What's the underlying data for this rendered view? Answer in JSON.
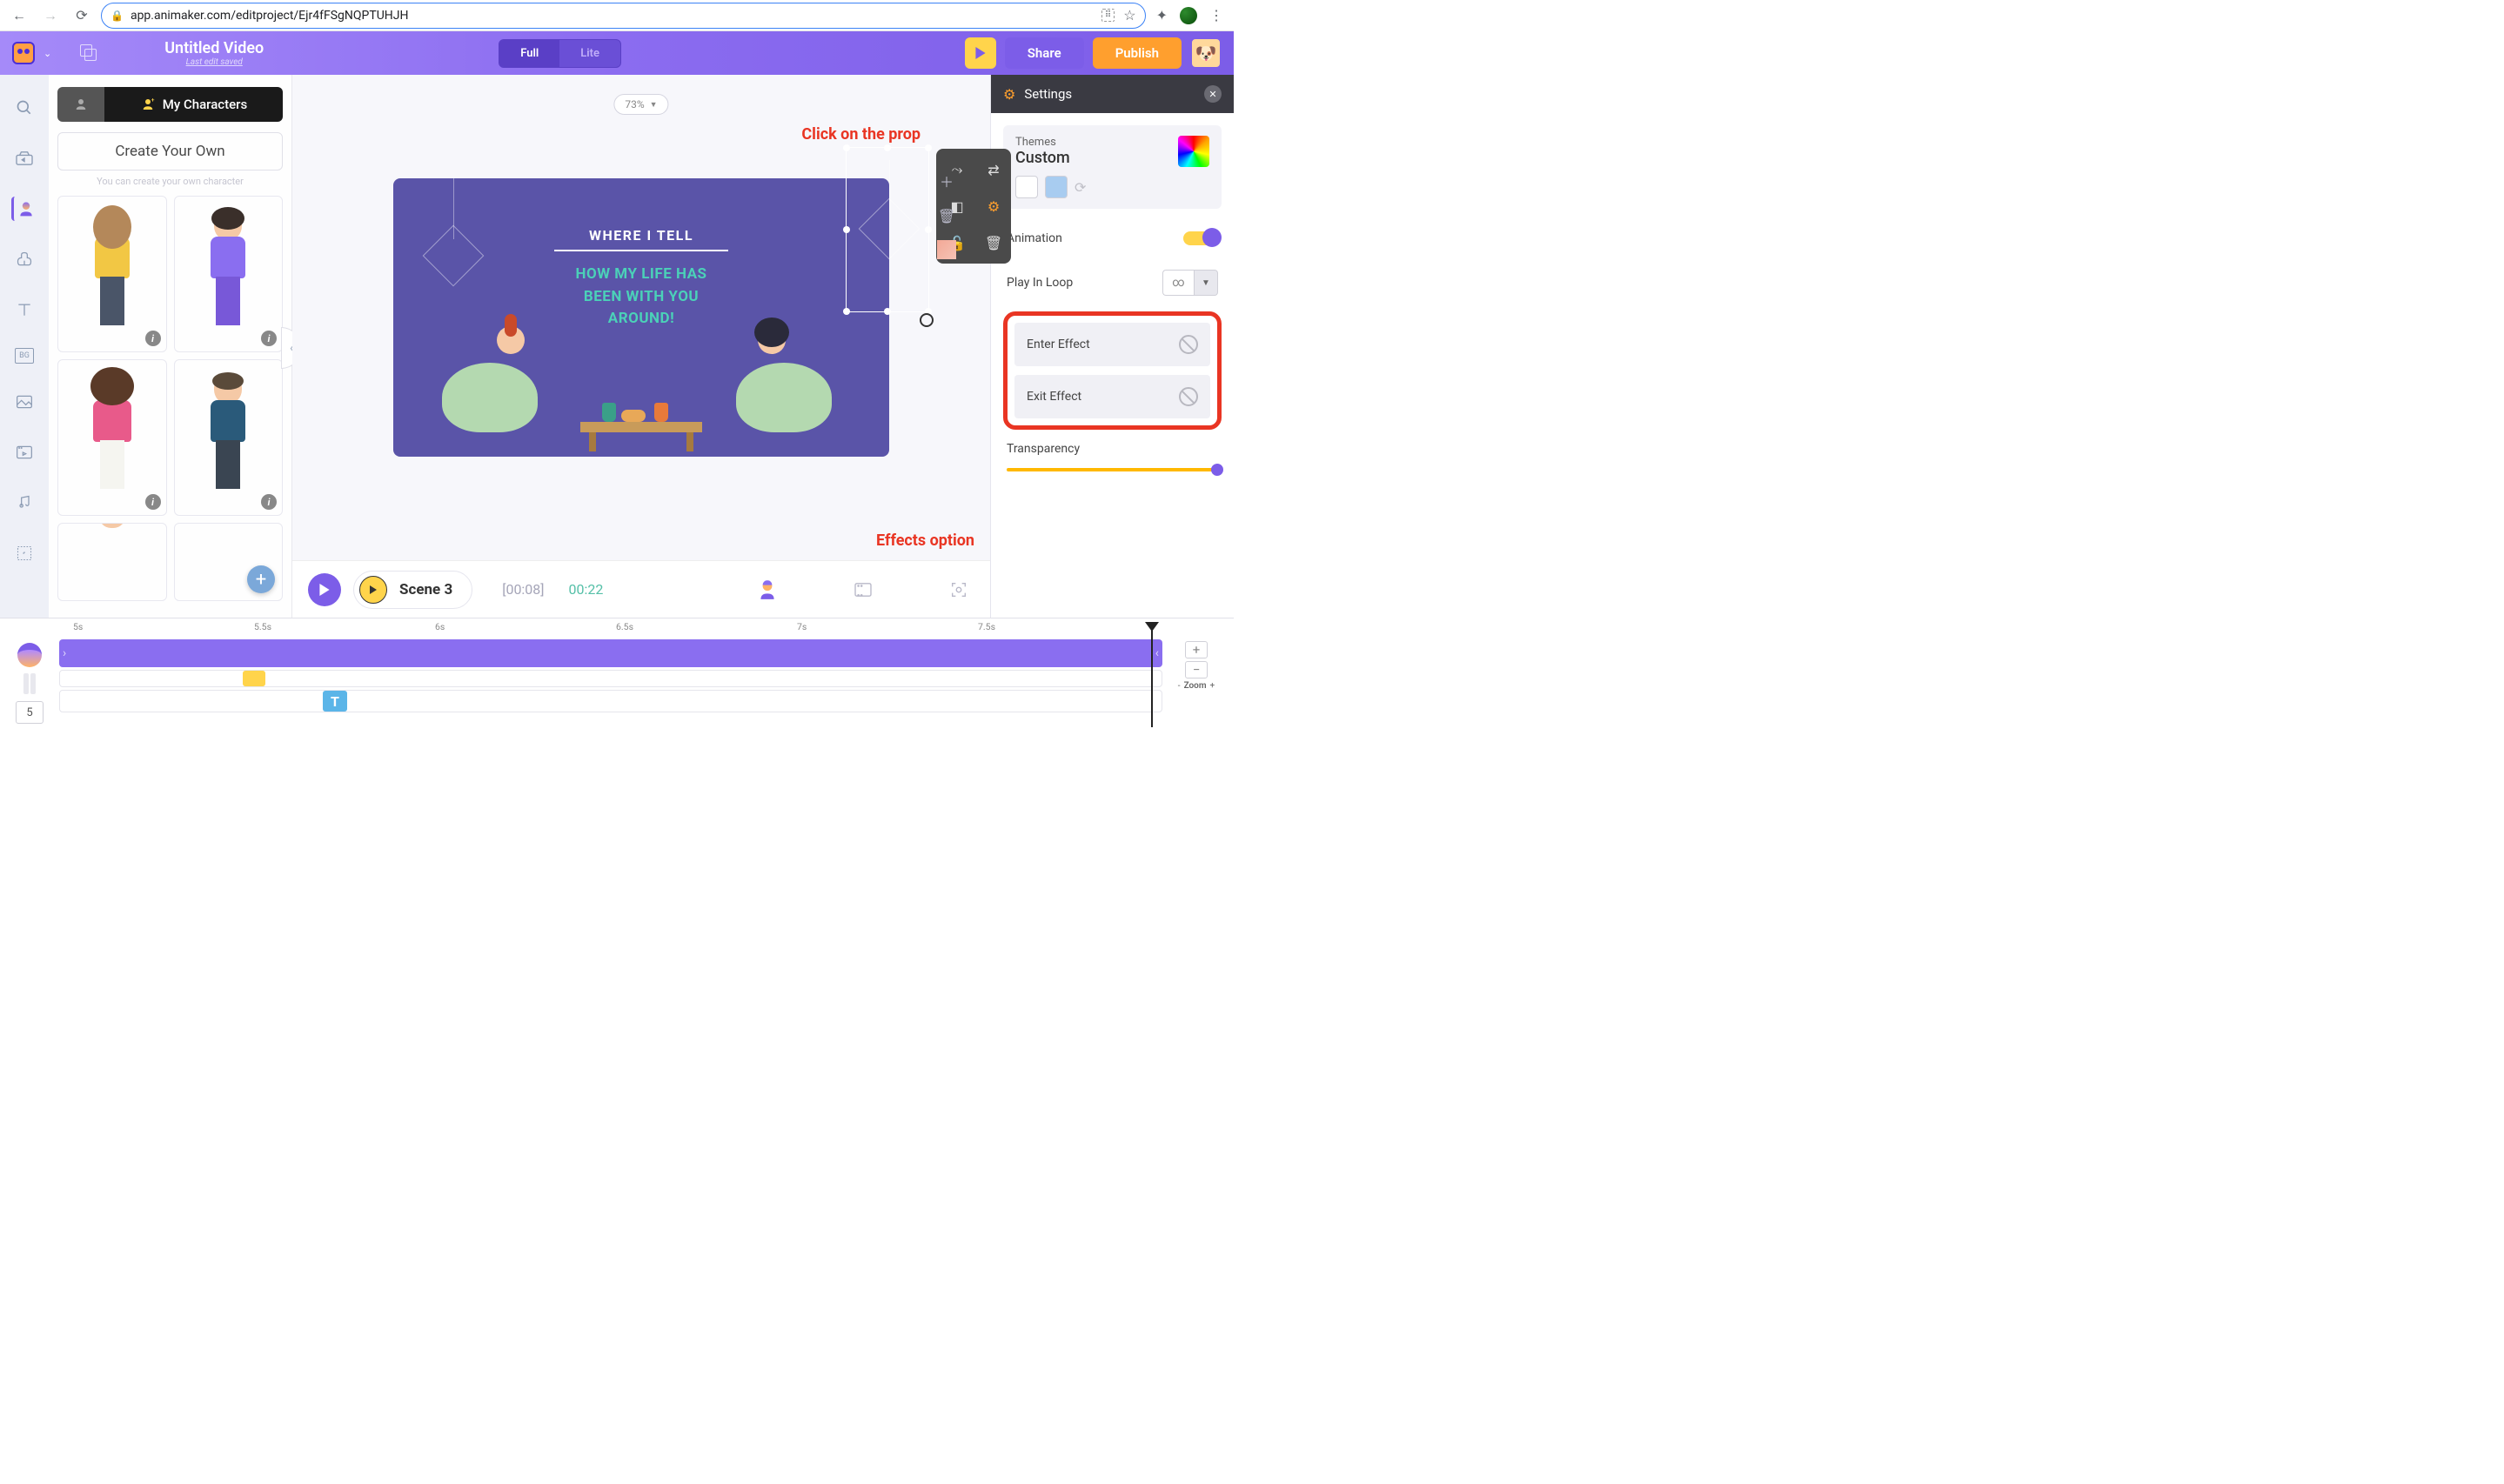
{
  "browser": {
    "url": "app.animaker.com/editproject/Ejr4fFSgNQPTUHJH"
  },
  "header": {
    "title": "Untitled Video",
    "subtitle": "Last edit saved",
    "mode_full": "Full",
    "mode_lite": "Lite",
    "share": "Share",
    "publish": "Publish"
  },
  "char_panel": {
    "tab_label": "My Characters",
    "create_own": "Create Your Own",
    "create_own_sub": "You can create your own character"
  },
  "canvas": {
    "zoom": "73%",
    "text1": "WHERE I TELL",
    "text2": "HOW MY LIFE HAS\nBEEN WITH YOU\nAROUND!"
  },
  "annotations": {
    "prop": "Click on the prop",
    "effects": "Effects option"
  },
  "scene_bar": {
    "label": "Scene 3",
    "time_elapsed": "[00:08]",
    "time_total": "00:22"
  },
  "settings": {
    "title": "Settings",
    "themes_label": "Themes",
    "themes_value": "Custom",
    "animation": "Animation",
    "play_loop": "Play In Loop",
    "enter_effect": "Enter Effect",
    "exit_effect": "Exit Effect",
    "transparency": "Transparency"
  },
  "timeline": {
    "ticks": [
      "5s",
      "5.5s",
      "6s",
      "6.5s",
      "7s",
      "7.5s"
    ],
    "frame": "5",
    "zoom_label": "Zoom",
    "clip_letter": "T"
  }
}
